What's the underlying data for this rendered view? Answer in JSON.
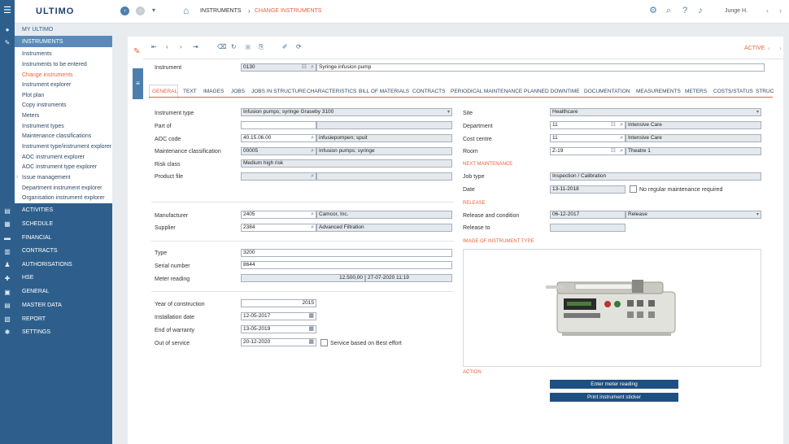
{
  "app": {
    "logo": "ULTIMO",
    "user": "Junge H."
  },
  "breadcrumb": {
    "item1": "INSTRUMENTS",
    "item2": "CHANGE INSTRUMENTS"
  },
  "menu": {
    "my_ultimo": "MY ULTIMO",
    "instruments": "INSTRUMENTS",
    "submenu": [
      "Instruments",
      "Instruments to be entered",
      "Change instruments",
      "Instrument explorer",
      "Plot plan",
      "Copy instruments",
      "Meters",
      "Instrument types",
      "Maintenance classifications",
      "Instrument type/instrument explorer",
      "AOC instrument explorer",
      "AOC instrument type explorer",
      "Issue management",
      "Department instrument explorer",
      "Organisation instrument explorer"
    ],
    "modules": [
      "ACTIVITIES",
      "SCHEDULE",
      "FINANCIAL",
      "CONTRACTS",
      "AUTHORISATIONS",
      "HSE",
      "GENERAL",
      "MASTER DATA",
      "REPORT",
      "SETTINGS"
    ]
  },
  "record": {
    "status": "ACTIVE"
  },
  "instrument": {
    "label": "Instrument",
    "code": "0130",
    "description": "Syringe infusion pump"
  },
  "tabs": [
    "GENERAL",
    "TEXT",
    "IMAGES",
    "JOBS",
    "JOBS IN STRUCTURE",
    "CHARACTERISTICS",
    "BILL OF MATERIALS",
    "CONTRACTS",
    "PERIODICAL MAINTENANCE",
    "PLANNED DOWNTIME",
    "DOCUMENTATION",
    "MEASUREMENTS",
    "METERS",
    "COSTS/STATUS",
    "STRUC"
  ],
  "left": {
    "instrument_type_label": "Instrument type",
    "instrument_type": "Infusion pumps; syringe Graseby 3100",
    "part_of_label": "Part of",
    "part_of_code": "",
    "part_of_desc": "",
    "aoc_code_label": "AOC code",
    "aoc_code": "40.15.06.00",
    "aoc_desc": "infusiepompen; spuit",
    "maint_class_label": "Maintenance classification",
    "maint_class_code": "00005",
    "maint_class_desc": "Infusion pumps; syringe",
    "risk_class_label": "Risk class",
    "risk_class": "Medium high risk",
    "product_file_label": "Product file",
    "product_file_code": "",
    "product_file_desc": "",
    "manufacturer_label": "Manufacturer",
    "manufacturer_code": "2405",
    "manufacturer_name": "Camcor, Inc.",
    "supplier_label": "Supplier",
    "supplier_code": "2384",
    "supplier_name": "Advanced Filtration",
    "type_label": "Type",
    "type": "3200",
    "serial_label": "Serial number",
    "serial": "8644",
    "meter_label": "Meter reading",
    "meter_value": "12.500,00",
    "meter_date": "27-07-2020 11:19",
    "year_label": "Year of construction",
    "year": "2015",
    "install_label": "Installation date",
    "install": "12-05-2017",
    "warranty_label": "End of warranty",
    "warranty": "13-05-2019",
    "out_label": "Out of service",
    "out": "20-12-2020",
    "best_effort_label": "Service based on Best effort"
  },
  "right": {
    "site_label": "Site",
    "site": "Healthcare",
    "dept_label": "Department",
    "dept_code": "11",
    "dept_name": "Intensive Care",
    "cost_label": "Cost centre",
    "cost_code": "11",
    "cost_name": "Intensive Care",
    "room_label": "Room",
    "room_code": "Z-19",
    "room_name": "Theatre 1",
    "next_maint_header": "NEXT MAINTENANCE",
    "job_type_label": "Job type",
    "job_type": "Inspection / Calibration",
    "date_label": "Date",
    "date": "13-11-2018",
    "no_regular_label": "No regular maintenance required",
    "release_header": "RELEASE",
    "release_cond_label": "Release and condition",
    "release_date": "06-12-2017",
    "release_value": "Release",
    "release_to_label": "Release to",
    "release_to": "",
    "image_header": "IMAGE OF INSTRUMENT TYPE",
    "action_header": "ACTION",
    "btn_meter": "Enter meter reading",
    "btn_sticker": "Print instrument sticker"
  },
  "colors": {
    "accent": "#e8633a",
    "nav": "#2e5f8c",
    "button": "#1f4f82"
  }
}
